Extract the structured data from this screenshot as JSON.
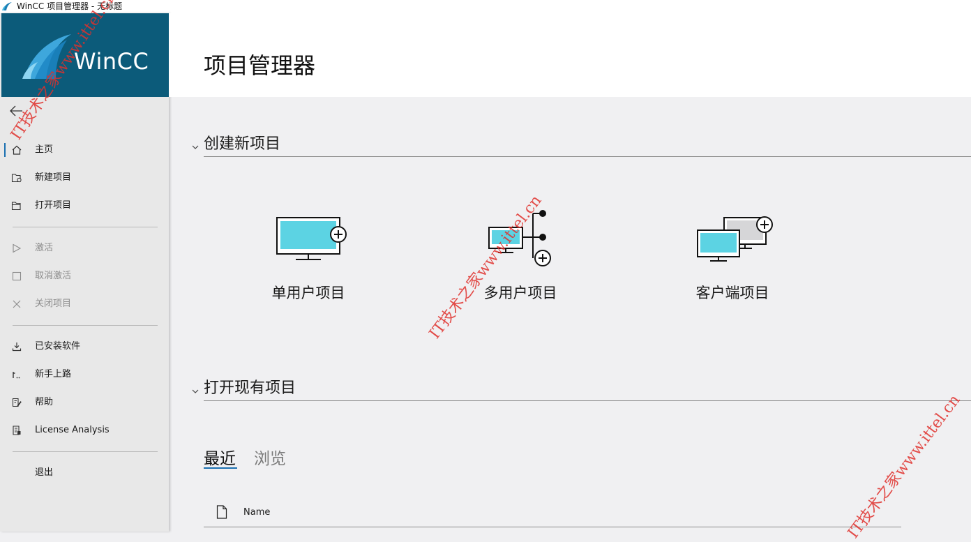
{
  "window": {
    "title": "WinCC 项目管理器 - 无标题"
  },
  "logo": {
    "text": "WinCC",
    "colors": {
      "background": "#0c5b7a",
      "swoosh": "#4fb0e0"
    }
  },
  "sidebar": {
    "back_icon": "arrow-left-icon",
    "groups": [
      [
        {
          "label": "主页",
          "icon": "home-icon",
          "active": true,
          "enabled": true
        },
        {
          "label": "新建项目",
          "icon": "new-project-icon",
          "enabled": true
        },
        {
          "label": "打开项目",
          "icon": "folder-open-icon",
          "enabled": true
        }
      ],
      [
        {
          "label": "激活",
          "icon": "play-icon",
          "enabled": false
        },
        {
          "label": "取消激活",
          "icon": "stop-icon",
          "enabled": false
        },
        {
          "label": "关闭项目",
          "icon": "close-icon",
          "enabled": false
        }
      ],
      [
        {
          "label": "已安装软件",
          "icon": "download-icon",
          "enabled": true
        },
        {
          "label": "新手上路",
          "icon": "getting-started-icon",
          "enabled": true
        },
        {
          "label": "帮助",
          "icon": "help-icon",
          "enabled": true
        },
        {
          "label": "License Analysis",
          "icon": "license-icon",
          "enabled": true
        }
      ],
      [
        {
          "label": "退出",
          "icon": "",
          "enabled": true
        }
      ]
    ]
  },
  "header": {
    "title": "项目管理器"
  },
  "create_section": {
    "title": "创建新项目",
    "cards": [
      {
        "label": "单用户项目",
        "icon": "single-user-monitor-icon"
      },
      {
        "label": "多用户项目",
        "icon": "multi-user-network-icon"
      },
      {
        "label": "客户端项目",
        "icon": "client-monitors-icon"
      }
    ]
  },
  "open_section": {
    "title": "打开现有项目",
    "tabs": [
      {
        "label": "最近",
        "active": true
      },
      {
        "label": "浏览",
        "active": false
      }
    ],
    "columns": [
      {
        "label": "Name",
        "icon": "document-icon"
      }
    ]
  },
  "watermarks": [
    "IT技术之家www.ittel.cn",
    "IT技术之家www.ittel.cn",
    "IT技术之家www.ittel.cn"
  ],
  "colors": {
    "accent": "#1a6fb0",
    "monitor_screen": "#5cd3e3",
    "watermark": "#e0302c"
  }
}
